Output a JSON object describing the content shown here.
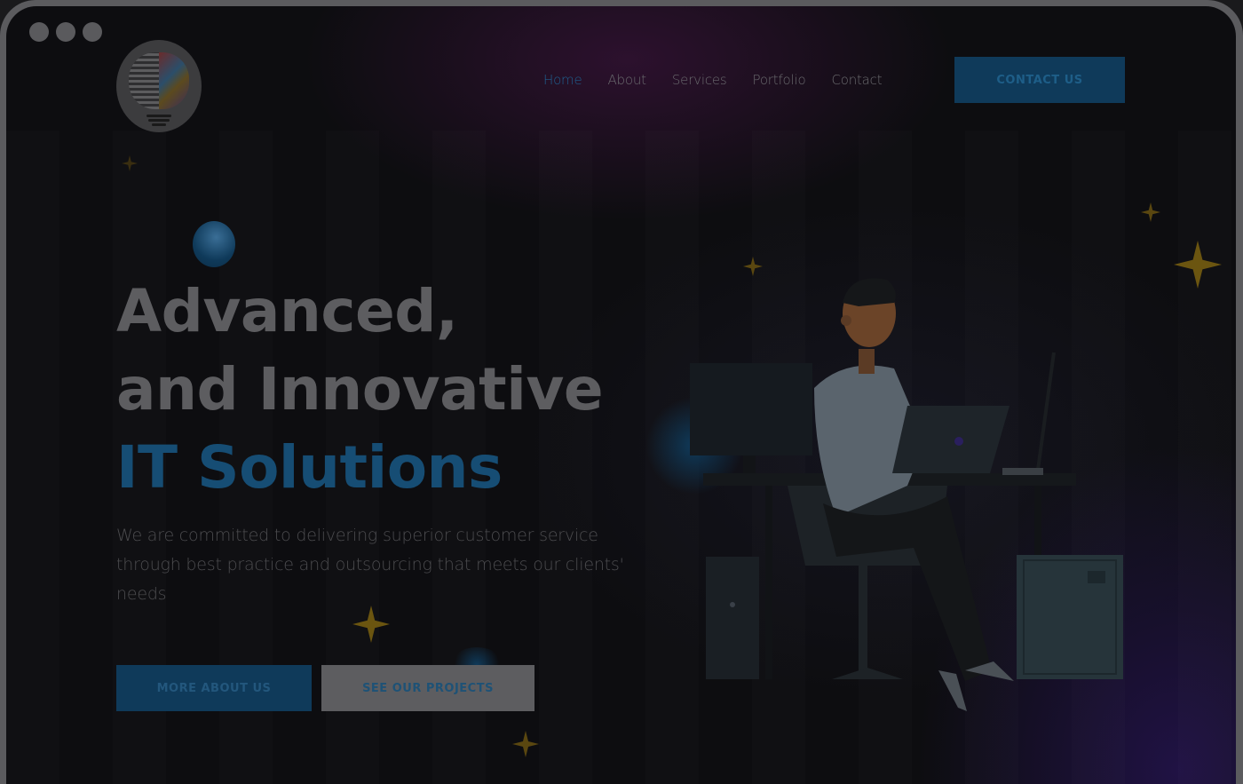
{
  "window": {
    "controls": [
      "dot-1",
      "dot-2",
      "dot-3"
    ]
  },
  "logo": {
    "name": "brain-bulb-logo"
  },
  "nav": {
    "items": [
      {
        "label": "Home",
        "active": true
      },
      {
        "label": "About",
        "active": false
      },
      {
        "label": "Services",
        "active": false
      },
      {
        "label": "Portfolio",
        "active": false
      },
      {
        "label": "Contact",
        "active": false
      }
    ]
  },
  "header": {
    "cta_label": "CONTACT US"
  },
  "hero": {
    "title_line1": "Advanced,",
    "title_line2": "and Innovative",
    "title_line3": "IT Solutions",
    "subtitle": "We are committed to delivering superior customer service through best practice and outsourcing that meets our clients' needs",
    "primary_button": "MORE ABOUT US",
    "secondary_button": "SEE OUR PROJECTS"
  },
  "colors": {
    "accent": "#164d74",
    "star": "#6b5510",
    "background": "#0d0d10"
  },
  "illustration": {
    "name": "developer-at-desk-illustration"
  }
}
